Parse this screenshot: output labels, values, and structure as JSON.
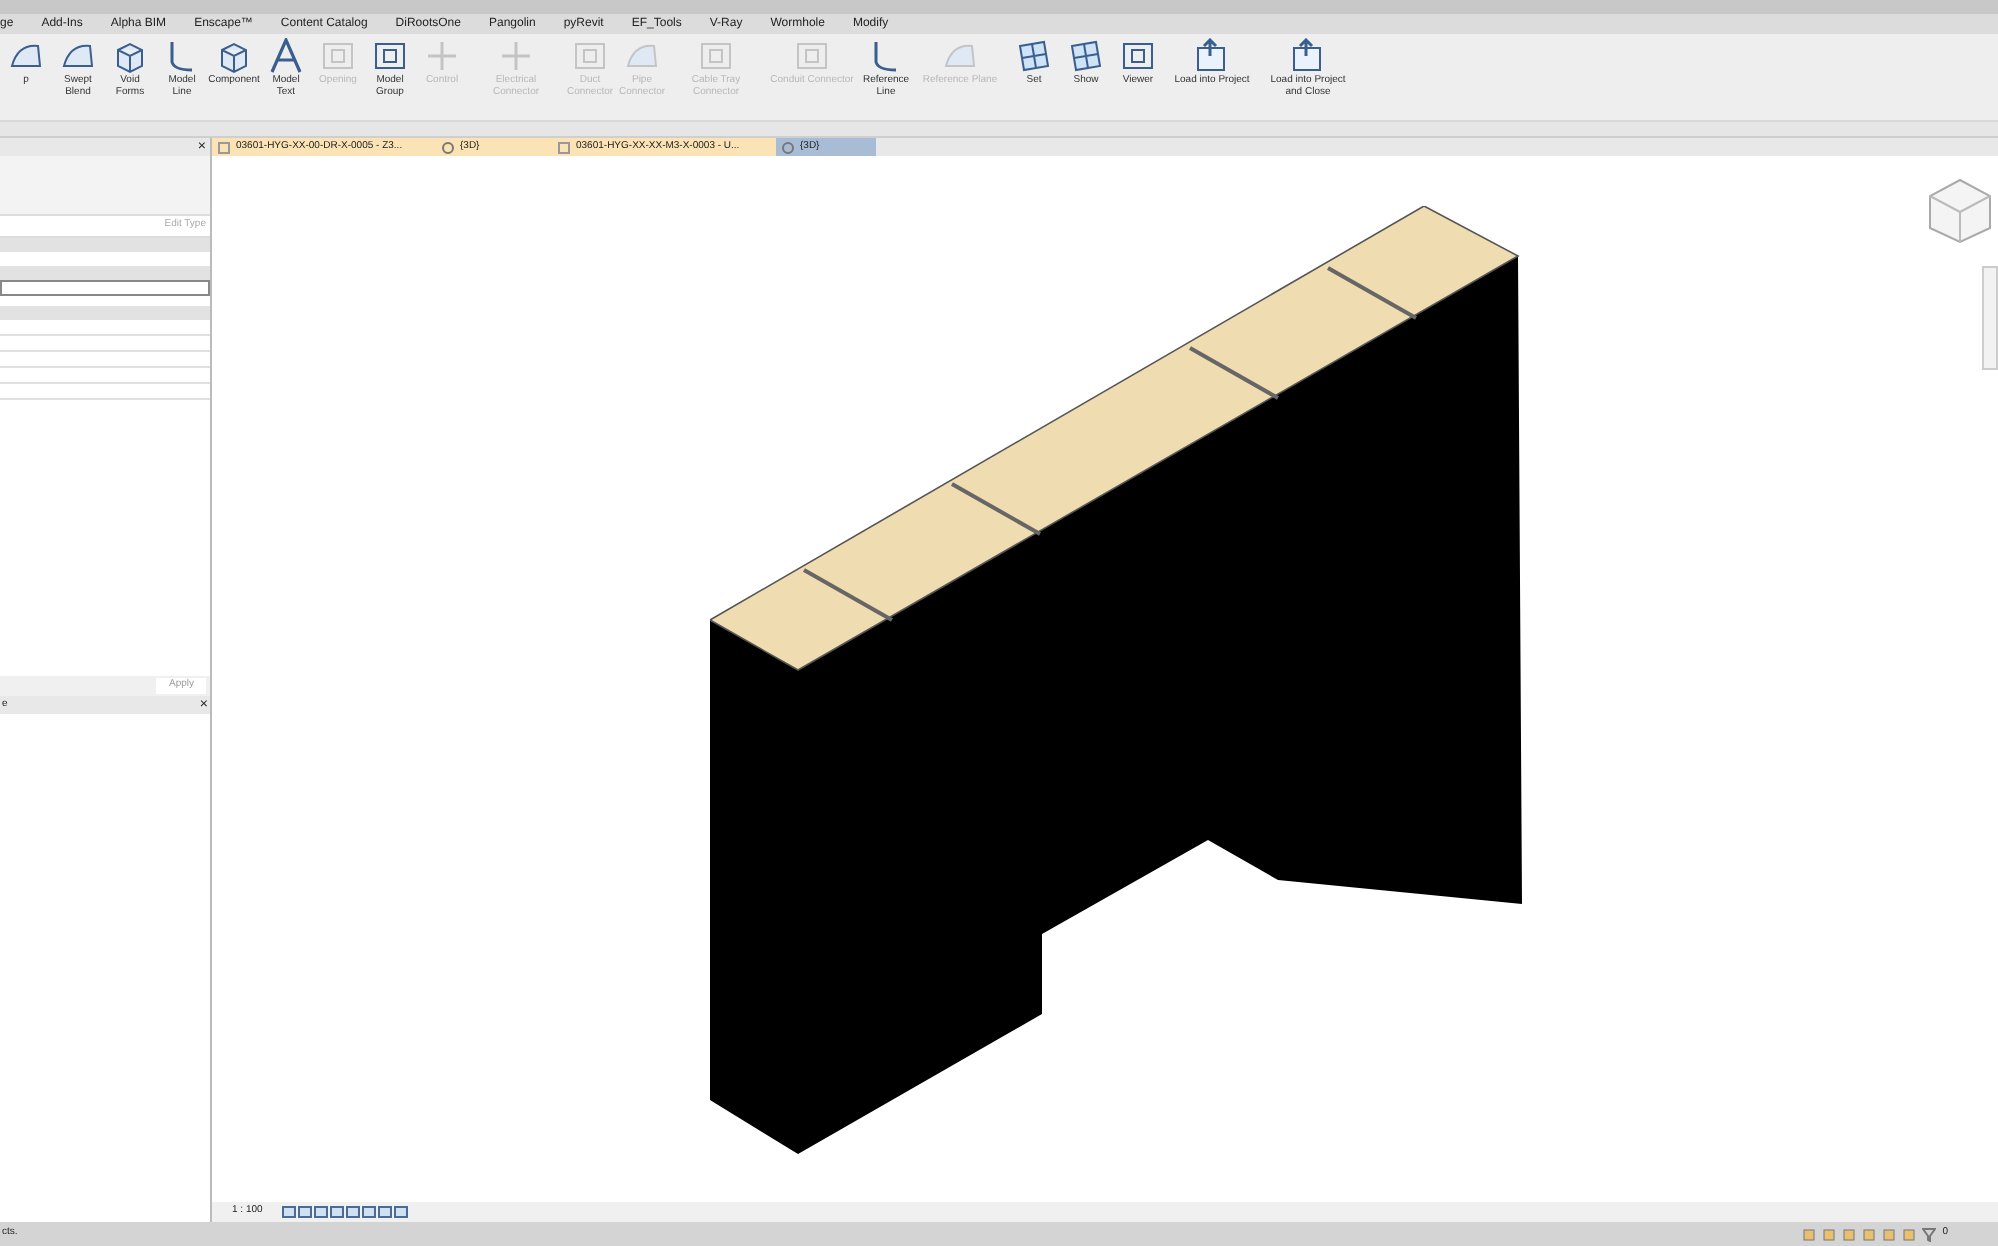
{
  "ribbon_tabs": [
    {
      "label": "ge"
    },
    {
      "label": "Add-Ins"
    },
    {
      "label": "Alpha BIM"
    },
    {
      "label": "Enscape™"
    },
    {
      "label": "Content Catalog"
    },
    {
      "label": "DiRootsOne"
    },
    {
      "label": "Pangolin"
    },
    {
      "label": "pyRevit"
    },
    {
      "label": "EF_Tools"
    },
    {
      "label": "V-Ray"
    },
    {
      "label": "Wormhole"
    },
    {
      "label": "Modify"
    }
  ],
  "ribbon_tools": [
    {
      "label": "p",
      "disabled": false
    },
    {
      "label": "Swept Blend",
      "disabled": false
    },
    {
      "label": "Void Forms",
      "disabled": false
    },
    {
      "label": "Model Line",
      "disabled": false
    },
    {
      "label": "Component",
      "disabled": false
    },
    {
      "label": "Model Text",
      "disabled": false
    },
    {
      "label": "Opening",
      "disabled": true
    },
    {
      "label": "Model Group",
      "disabled": false
    },
    {
      "label": "Control",
      "disabled": true
    },
    {
      "label": "Electrical Connector",
      "disabled": true
    },
    {
      "label": "Duct Connector",
      "disabled": true
    },
    {
      "label": "Pipe Connector",
      "disabled": true
    },
    {
      "label": "Cable Tray Connector",
      "disabled": true
    },
    {
      "label": "Conduit Connector",
      "disabled": true
    },
    {
      "label": "Reference Line",
      "disabled": false
    },
    {
      "label": "Reference Plane",
      "disabled": true
    },
    {
      "label": "Set",
      "disabled": false
    },
    {
      "label": "Show",
      "disabled": false
    },
    {
      "label": "Viewer",
      "disabled": false
    },
    {
      "label": "Load into Project",
      "disabled": false
    },
    {
      "label": "Load into Project and Close",
      "disabled": false
    }
  ],
  "properties": {
    "close": "×",
    "edit_type": "Edit Type",
    "apply": "Apply"
  },
  "project_browser": {
    "title": "e",
    "close": "×"
  },
  "view_tabs": [
    {
      "label": "03601-HYG-XX-00-DR-X-0005 - Z3...",
      "kind": "sheet",
      "selected": false
    },
    {
      "label": "{3D}",
      "kind": "view",
      "selected": false
    },
    {
      "label": "03601-HYG-XX-XX-M3-X-0003 - U...",
      "kind": "sheet",
      "selected": false
    },
    {
      "label": "{3D}",
      "kind": "view",
      "selected": true
    }
  ],
  "view_bar": {
    "scale": "1 : 100"
  },
  "status_bar": {
    "message": "cts.",
    "filter_count": "0"
  }
}
